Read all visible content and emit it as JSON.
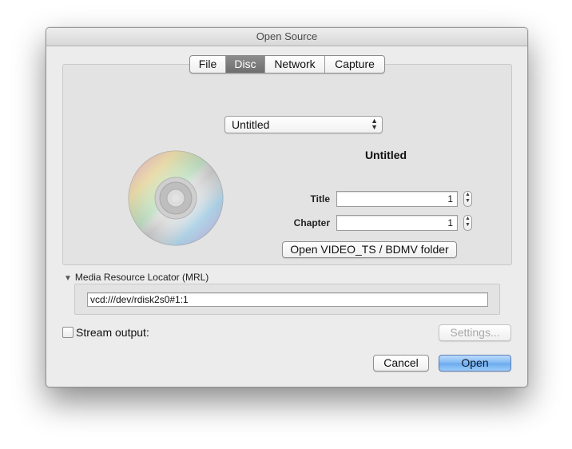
{
  "window": {
    "title": "Open Source"
  },
  "tabs": [
    {
      "label": "File",
      "active": false
    },
    {
      "label": "Disc",
      "active": true
    },
    {
      "label": "Network",
      "active": false
    },
    {
      "label": "Capture",
      "active": false
    }
  ],
  "disc": {
    "device_selected": "Untitled",
    "disc_name": "Untitled",
    "title_label": "Title",
    "title_value": "1",
    "chapter_label": "Chapter",
    "chapter_value": "1",
    "open_folder_label": "Open VIDEO_TS / BDMV folder",
    "icon": "cd-disc-icon"
  },
  "mrl": {
    "section_label": "Media Resource Locator (MRL)",
    "value": "vcd:///dev/rdisk2s0#1:1"
  },
  "stream": {
    "label": "Stream output:",
    "checked": false,
    "settings_label": "Settings..."
  },
  "actions": {
    "cancel_label": "Cancel",
    "open_label": "Open"
  },
  "colors": {
    "default_button": "#6aa9ef",
    "active_tab": "#7c7c7c"
  }
}
